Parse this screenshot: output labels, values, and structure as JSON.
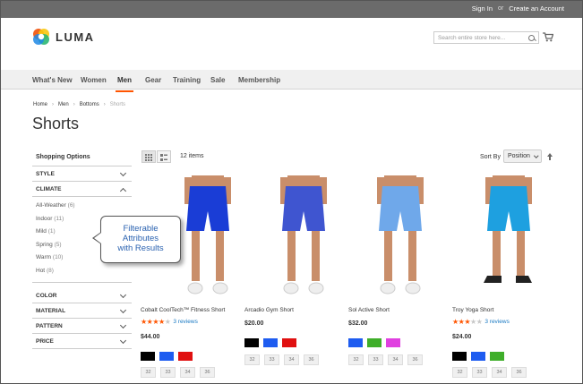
{
  "header": {
    "sign_in": "Sign In",
    "or": "or",
    "create_account": "Create an Account",
    "logo_text": "LUMA",
    "search_placeholder": "Search entire store here..."
  },
  "nav": {
    "items": [
      {
        "label": "What's New"
      },
      {
        "label": "Women"
      },
      {
        "label": "Men",
        "active": true
      },
      {
        "label": "Gear"
      },
      {
        "label": "Training"
      },
      {
        "label": "Sale"
      },
      {
        "label": "Membership"
      }
    ]
  },
  "breadcrumb": {
    "items": [
      "Home",
      "Men",
      "Bottoms"
    ],
    "current": "Shorts"
  },
  "page_title": "Shorts",
  "sidebar": {
    "title": "Shopping Options",
    "style_label": "STYLE",
    "climate_label": "CLIMATE",
    "climate_options": [
      {
        "label": "All-Weather",
        "count": "(6)"
      },
      {
        "label": "Indoor",
        "count": "(11)"
      },
      {
        "label": "Mild",
        "count": "(1)"
      },
      {
        "label": "Spring",
        "count": "(5)"
      },
      {
        "label": "Warm",
        "count": "(10)"
      },
      {
        "label": "Hot",
        "count": "(8)"
      }
    ],
    "filters_after": [
      {
        "label": "COLOR"
      },
      {
        "label": "MATERIAL"
      },
      {
        "label": "PATTERN"
      },
      {
        "label": "PRICE"
      }
    ]
  },
  "callout": {
    "line1": "Filterable",
    "line2": "Attributes",
    "line3": "with Results"
  },
  "toolbar": {
    "item_count": "12 items",
    "sort_label": "Sort By",
    "sort_value": "Position"
  },
  "products": [
    {
      "name": "Cobalt CoolTech™ Fitness Short",
      "stars": 4,
      "reviews": "3 reviews",
      "price": "$44.00",
      "short_color": "#1a3dd6",
      "swatches": [
        "#000000",
        "#1e5cf0",
        "#e01010"
      ],
      "sizes": [
        "32",
        "33",
        "34",
        "36"
      ]
    },
    {
      "name": "Arcadio Gym Short",
      "stars": 0,
      "reviews": "",
      "price": "$20.00",
      "short_color": "#3f55d0",
      "swatches": [
        "#000000",
        "#1e5cf0",
        "#e01010"
      ],
      "sizes": [
        "32",
        "33",
        "34",
        "36"
      ]
    },
    {
      "name": "Sol Active Short",
      "stars": 0,
      "reviews": "",
      "price": "$32.00",
      "short_color": "#6fa8ea",
      "swatches": [
        "#1e5cf0",
        "#3fae2a",
        "#e040e0"
      ],
      "sizes": [
        "32",
        "33",
        "34",
        "36"
      ]
    },
    {
      "name": "Troy Yoga Short",
      "stars": 3,
      "reviews": "3 reviews",
      "price": "$24.00",
      "short_color": "#1ea0e0",
      "swatches": [
        "#000000",
        "#1e5cf0",
        "#3fae2a"
      ],
      "sizes": [
        "32",
        "33",
        "34",
        "36"
      ]
    }
  ],
  "colors": {
    "accent": "#ff5501",
    "link": "#1979c3",
    "callout_text": "#2a62b0"
  }
}
